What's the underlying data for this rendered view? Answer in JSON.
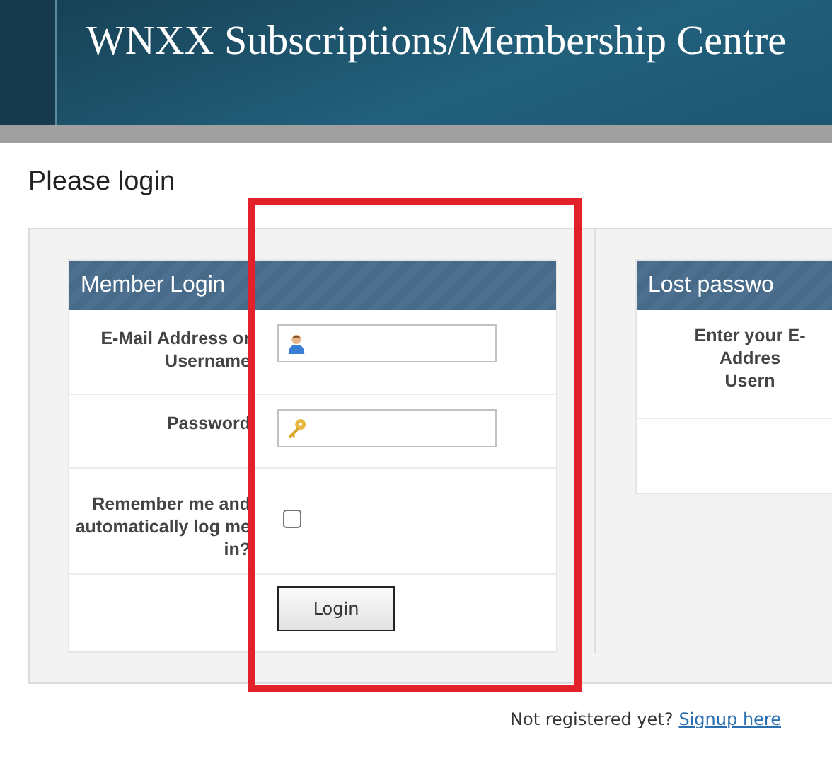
{
  "header": {
    "title": "WNXX Subscriptions/Membership Centre"
  },
  "page_title": "Please login",
  "login_box": {
    "title": "Member Login",
    "fields": [
      {
        "kind": "text",
        "label": "E-Mail Address or Username"
      },
      {
        "kind": "password",
        "label": "Password"
      },
      {
        "kind": "checkbox",
        "label": "Remember me and automatically log me in?",
        "checked": false
      }
    ],
    "button": "Login"
  },
  "lost_password_box": {
    "title": "Lost passwo",
    "label_lines": [
      "Enter your E-",
      "Addres",
      "Usern"
    ]
  },
  "footer": {
    "text": "Not registered yet?",
    "link": "Signup here"
  },
  "highlight": {
    "color": "#e3212b"
  }
}
